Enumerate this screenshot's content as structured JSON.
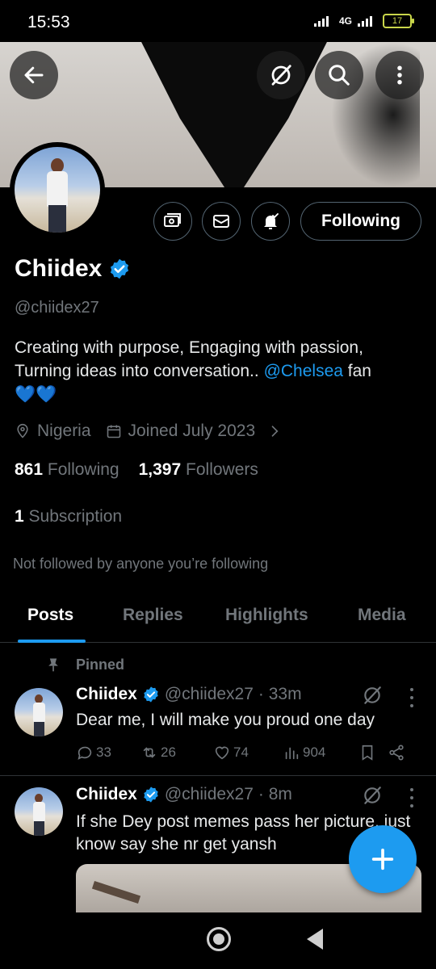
{
  "status_bar": {
    "time": "15:53",
    "network": "4G",
    "battery": "17"
  },
  "header": {
    "back_icon": "back-arrow-icon",
    "grok_icon": "grok-icon",
    "search_icon": "search-icon",
    "more_icon": "more-vertical-icon"
  },
  "profile": {
    "display_name": "Chiidex",
    "handle": "@chiidex27",
    "bio_text": "Creating with purpose, Engaging with passion, Turning ideas into conversation.. ",
    "bio_mention": "@Chelsea",
    "bio_after": " fan",
    "bio_emojis": "💙💙",
    "location": "Nigeria",
    "joined": "Joined July 2023",
    "following_count": "861",
    "following_label": "Following",
    "followers_count": "1,397",
    "followers_label": "Followers",
    "subscription_count": "1",
    "subscription_label": "Subscription",
    "not_followed_text": "Not followed by anyone you’re following",
    "follow_button_label": "Following",
    "verified_color": "#1d9bf0"
  },
  "tabs": [
    {
      "label": "Posts",
      "active": true
    },
    {
      "label": "Replies",
      "active": false
    },
    {
      "label": "Highlights",
      "active": false
    },
    {
      "label": "Media",
      "active": false
    }
  ],
  "pinned_label": "Pinned",
  "posts": [
    {
      "name": "Chiidex",
      "handle": "@chiidex27",
      "time": "· 33m",
      "text": "Dear me, I will make you proud one day",
      "replies": "33",
      "reposts": "26",
      "likes": "74",
      "views": "904"
    },
    {
      "name": "Chiidex",
      "handle": "@chiidex27",
      "time": "· 8m",
      "text": "If she Dey post memes pass her picture, just know say she nr get yansh"
    }
  ],
  "colors": {
    "accent": "#1d9bf0",
    "background": "#000000",
    "muted": "#71767b"
  }
}
